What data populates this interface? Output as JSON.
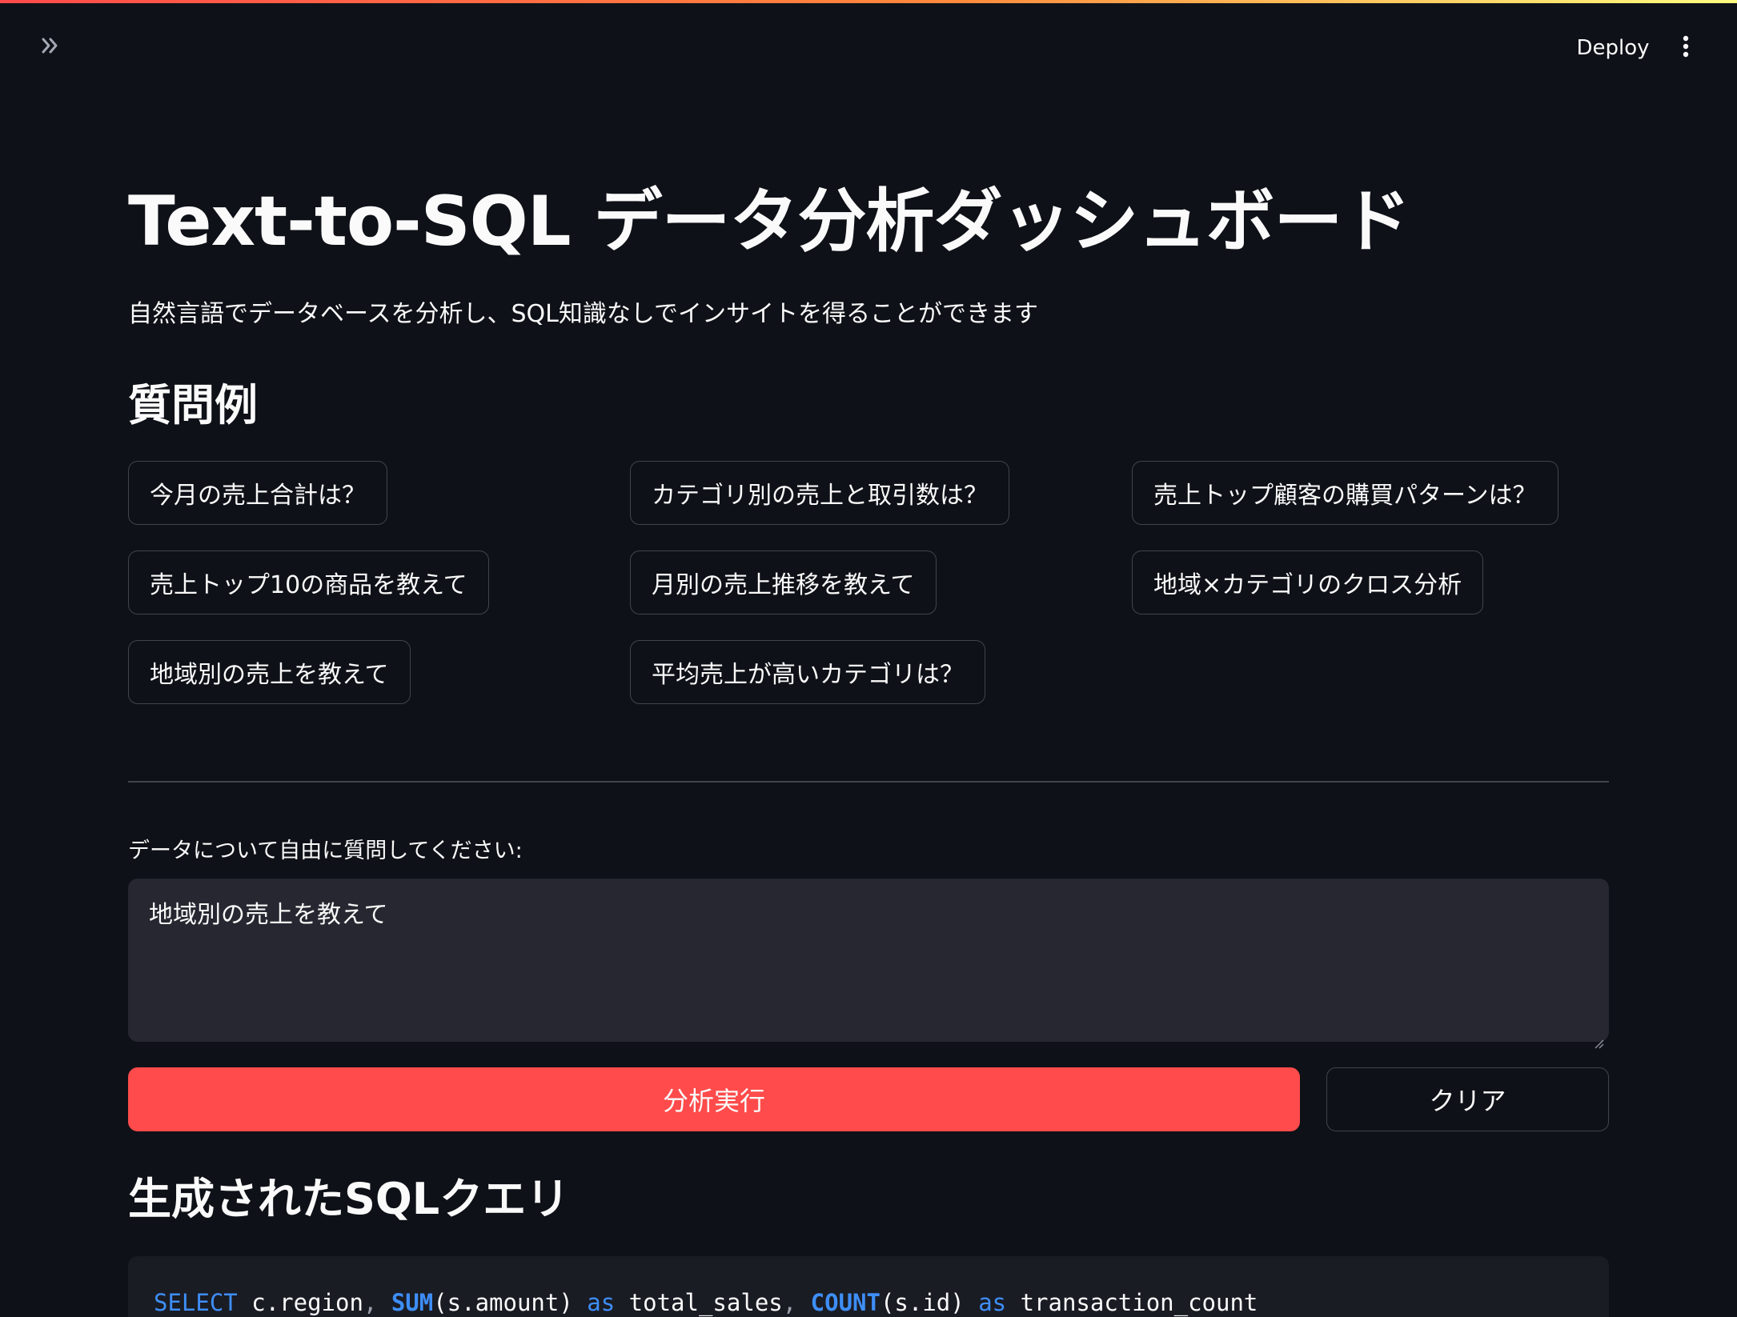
{
  "header": {
    "deploy_label": "Deploy",
    "sidebar_toggle_icon": "double-chevron-right-icon",
    "menu_icon": "vertical-ellipsis-icon"
  },
  "main": {
    "title": "Text-to-SQL データ分析ダッシュボード",
    "subtitle": "自然言語でデータベースを分析し、SQL知識なしでインサイトを得ることができます",
    "examples_title": "質問例",
    "examples": [
      "今月の売上合計は？",
      "カテゴリ別の売上と取引数は？",
      "売上トップ顧客の購買パターンは？",
      "売上トップ10の商品を教えて",
      "月別の売上推移を教えて",
      "地域×カテゴリのクロス分析",
      "地域別の売上を教えて",
      "平均売上が高いカテゴリは？"
    ],
    "input_label": "データについて自由に質問してください:",
    "input_value": "地域別の売上を教えて",
    "run_button_label": "分析実行",
    "clear_button_label": "クリア",
    "sql_title": "生成されたSQLクエリ",
    "sql_tokens": {
      "select": "SELECT",
      "region": " c.region",
      "comma1": ",",
      "sum": " SUM",
      "sum_arg": "(s.amount)",
      "as1": " as",
      "total_sales": " total_sales",
      "comma2": ",",
      "count": " COUNT",
      "count_arg": "(s.id)",
      "as2": " as",
      "transaction_count": " transaction_count"
    }
  },
  "colors": {
    "background": "#0e1117",
    "primary": "#ff4b4b",
    "textarea_bg": "#262730",
    "code_bg": "#1a1c24",
    "keyword": "#3e8ef7"
  }
}
